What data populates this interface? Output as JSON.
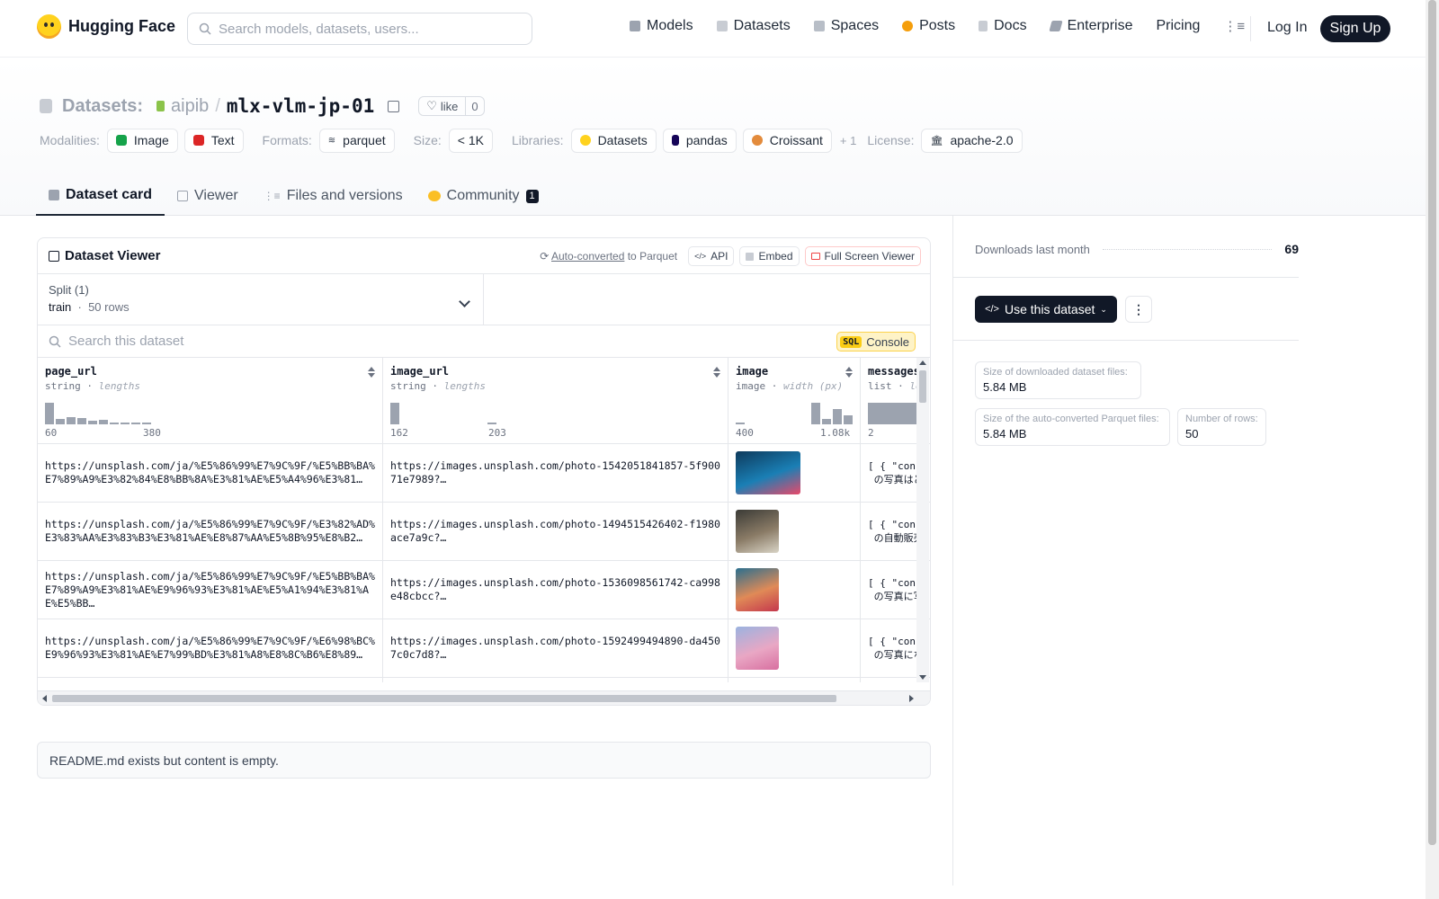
{
  "header": {
    "brand": "Hugging Face",
    "search_placeholder": "Search models, datasets, users...",
    "nav": [
      {
        "label": "Models",
        "color": "#9ca3af"
      },
      {
        "label": "Datasets",
        "color": "#c8ccd3"
      },
      {
        "label": "Spaces",
        "color": "#b8bec7"
      },
      {
        "label": "Posts",
        "color": "#f59e0b"
      },
      {
        "label": "Docs",
        "color": "#c8ccd3"
      },
      {
        "label": "Enterprise",
        "color": "#9ca3af"
      },
      {
        "label": "Pricing"
      }
    ],
    "login": "Log In",
    "signup": "Sign Up"
  },
  "repo": {
    "type_label": "Datasets:",
    "org": "aipib",
    "slash": "/",
    "name": "mlx-vlm-jp-01",
    "like_label": "like",
    "like_count": "0"
  },
  "meta": {
    "modalities_label": "Modalities:",
    "modalities": [
      "Image",
      "Text"
    ],
    "formats_label": "Formats:",
    "formats": [
      "parquet"
    ],
    "size_label": "Size:",
    "size": "< 1K",
    "libraries_label": "Libraries:",
    "libraries": [
      "Datasets",
      "pandas",
      "Croissant"
    ],
    "libraries_more": "+ 1",
    "license_label": "License:",
    "license": "apache-2.0"
  },
  "tabs": [
    {
      "label": "Dataset card",
      "active": true
    },
    {
      "label": "Viewer"
    },
    {
      "label": "Files and versions"
    },
    {
      "label": "Community",
      "badge": "1"
    }
  ],
  "viewer": {
    "title": "Dataset Viewer",
    "auto_converted": "Auto-converted",
    "to_parquet": " to Parquet",
    "api": "API",
    "embed": "Embed",
    "full_screen": "Full Screen Viewer",
    "split_label": "Split (1)",
    "split_value": "train",
    "split_rows": "50 rows",
    "search_placeholder": "Search this dataset",
    "sql_tag": "SQL",
    "console": "Console",
    "columns": [
      {
        "name": "page_url",
        "type": "string",
        "stat": "lengths",
        "min": "60",
        "max": "380",
        "hist": [
          1.0,
          0.25,
          0.35,
          0.3,
          0.18,
          0.2,
          0.08,
          0.1,
          0.08,
          0.06
        ]
      },
      {
        "name": "image_url",
        "type": "string",
        "stat": "lengths",
        "min": "162",
        "max": "203",
        "hist": [
          1.0,
          0,
          0,
          0,
          0,
          0,
          0,
          0,
          0,
          0.05
        ]
      },
      {
        "name": "image",
        "type": "image",
        "stat": "width (px)",
        "min": "400",
        "max": "1.08k",
        "hist": [
          0.1,
          0,
          0,
          0,
          0,
          0,
          0,
          1.0,
          0.25,
          0.7,
          0.4
        ]
      },
      {
        "name": "messages",
        "type": "list",
        "stat": "le",
        "min": "2",
        "max": "",
        "hist": [
          1.0
        ]
      }
    ],
    "rows": [
      {
        "page_url": "https://unsplash.com/ja/%E5%86%99%E7%9C%9F/%E5%BB%BA%E7%89%A9%E3%82%84%E8%BB%8A%E3%81%AE%E5%A4%96%E3%81…",
        "image_url": "https://images.unsplash.com/photo-1542051841857-5f90071e7989?…",
        "image_colors": [
          "#0e3a5c",
          "#1a7fb5",
          "#e8496a"
        ],
        "messages": "[ { \"con\n の写真はど"
      },
      {
        "page_url": "https://unsplash.com/ja/%E5%86%99%E7%9C%9F/%E3%82%AD%E3%83%AA%E3%83%B3%E3%81%AE%E8%87%AA%E5%8B%95%E8%B2…",
        "image_url": "https://images.unsplash.com/photo-1494515426402-f1980ace7a9c?…",
        "image_colors": [
          "#3b3b36",
          "#8a7b66",
          "#d9d4c6"
        ],
        "messages": "[ { \"con\n の自動販売"
      },
      {
        "page_url": "https://unsplash.com/ja/%E5%86%99%E7%9C%9F/%E5%BB%BA%E7%89%A9%E3%81%AE%E9%96%93%E3%81%AE%E5%A1%94%E3%81%AE%E5%BB…",
        "image_url": "https://images.unsplash.com/photo-1536098561742-ca998e48cbcc?…",
        "image_colors": [
          "#2a6f8f",
          "#e08a57",
          "#c4384d"
        ],
        "messages": "[ { \"con\n の写真に写"
      },
      {
        "page_url": "https://unsplash.com/ja/%E5%86%99%E7%9C%9F/%E6%98%BC%E9%96%93%E3%81%AE%E7%99%BD%E3%81%A8%E8%8C%B6%E8%89…",
        "image_url": "https://images.unsplash.com/photo-1592499494890-da4507c0c7d8?…",
        "image_colors": [
          "#9bb3e0",
          "#e9a7c4",
          "#d86fa0"
        ],
        "messages": "[ { \"con\n の写真にな"
      }
    ]
  },
  "readme_text": "README.md exists but content is empty.",
  "sidebar": {
    "downloads_label": "Downloads last month",
    "downloads_value": "69",
    "use_button": "Use this dataset",
    "more_label": "⋮",
    "size_downloaded_label": "Size of downloaded dataset files:",
    "size_downloaded": "5.84 MB",
    "size_parquet_label": "Size of the auto-converted Parquet files:",
    "size_parquet": "5.84 MB",
    "rows_label": "Number of rows:",
    "rows_value": "50"
  }
}
